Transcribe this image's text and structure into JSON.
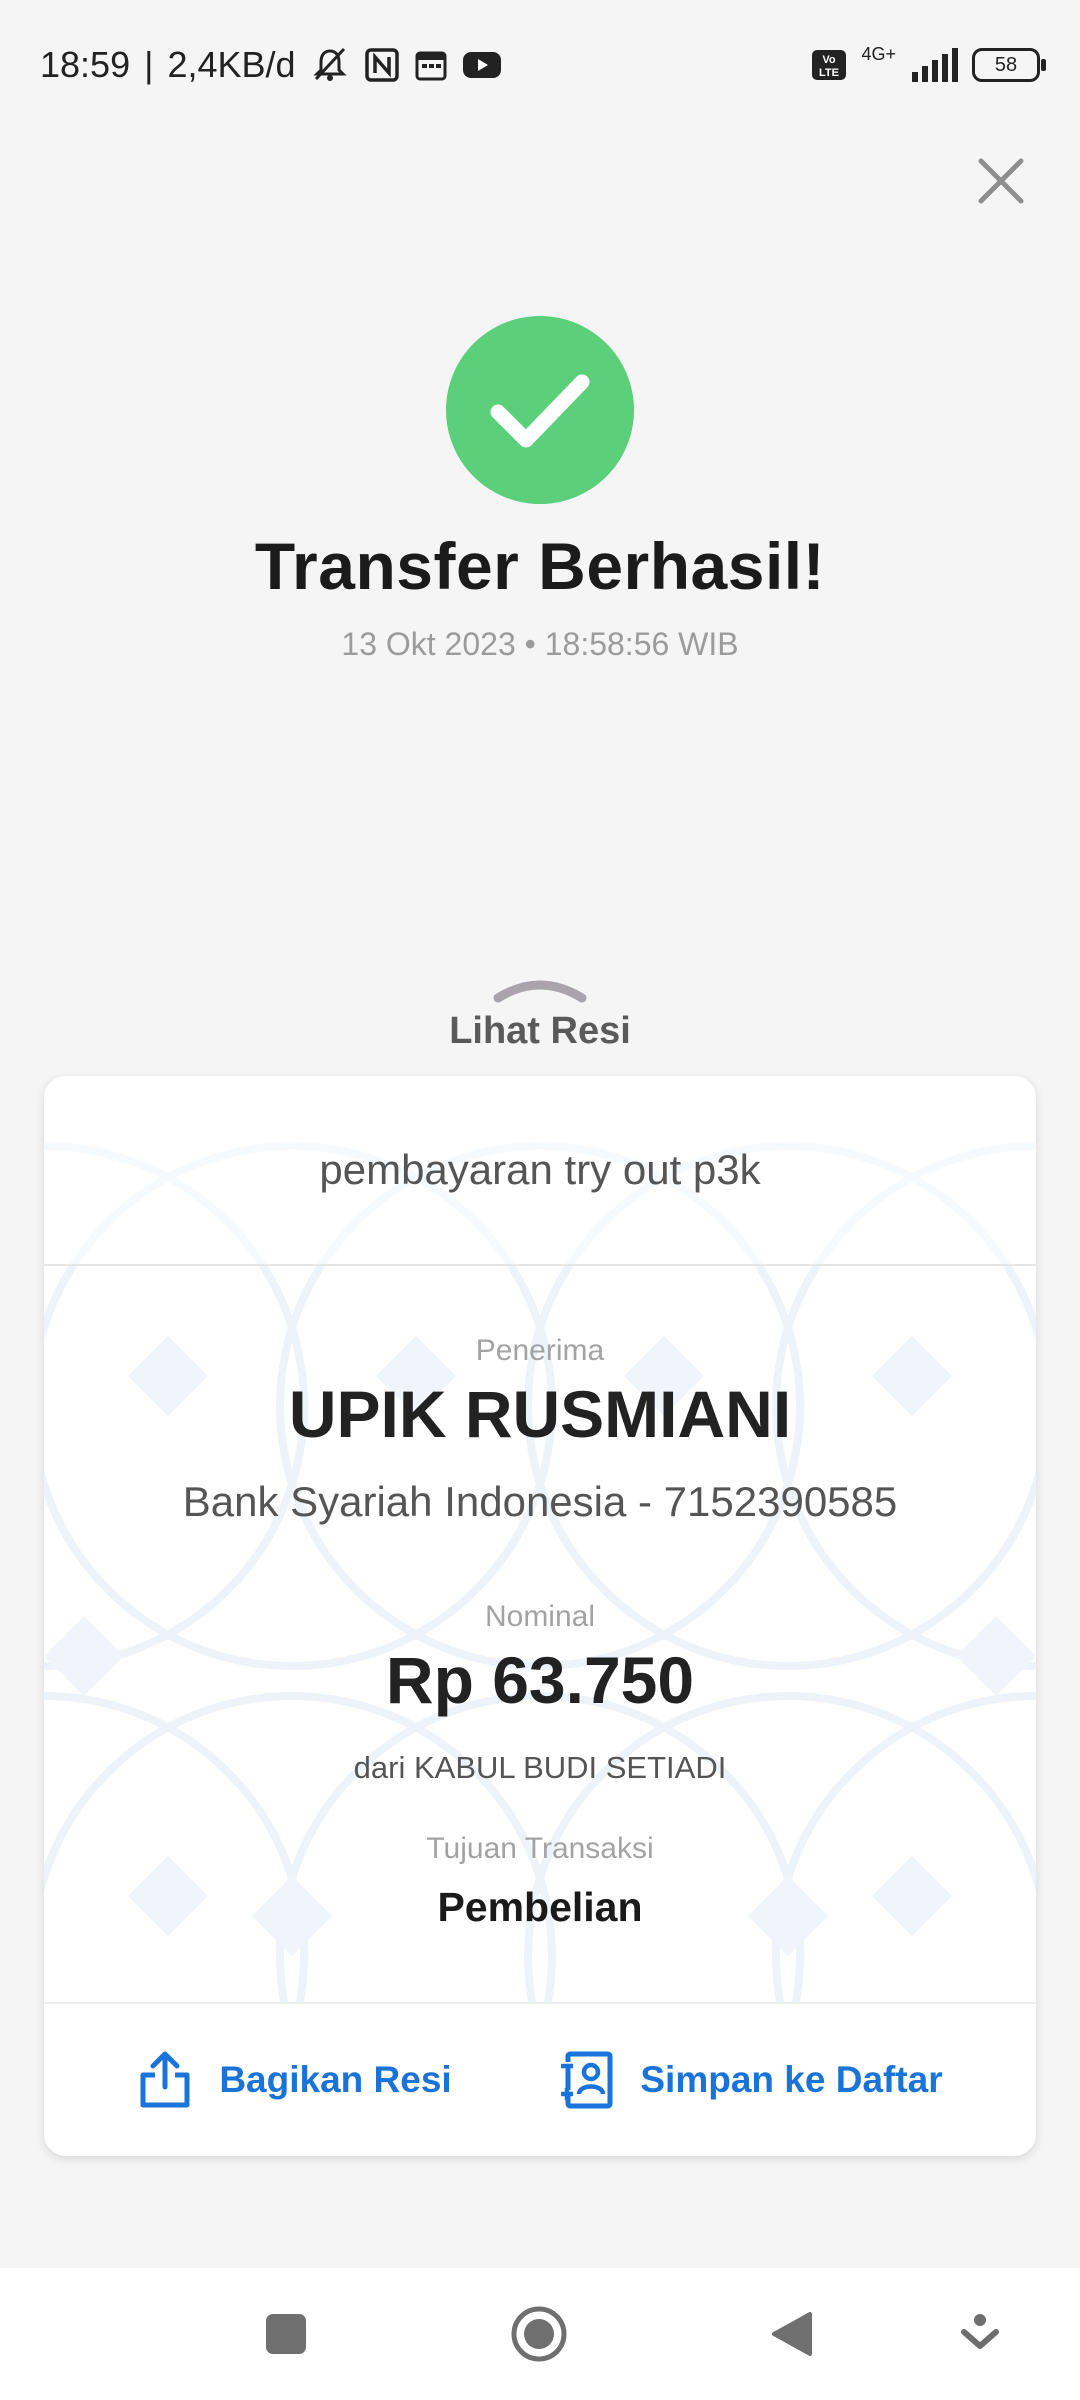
{
  "status_bar": {
    "time": "18:59",
    "separator": "|",
    "net_speed": "2,4KB/d",
    "network_label": "4G+",
    "volte_label": "Vo LTE",
    "battery": "58",
    "icons": [
      "mute-bell-icon",
      "nfc-icon",
      "calendar-icon",
      "youtube-icon",
      "volte-icon",
      "signal-icon",
      "battery-icon"
    ]
  },
  "header": {
    "close_icon": "close-icon",
    "success_icon": "check-circle-icon",
    "title": "Transfer Berhasil!",
    "datetime": "13 Okt 2023 • 18:58:56 WIB"
  },
  "receipt_toggle": {
    "label": "Lihat Resi",
    "icon": "chevron-up-icon"
  },
  "receipt": {
    "note": "pembayaran try out p3k",
    "recipient_label": "Penerima",
    "recipient_name": "UPIK RUSMIANI",
    "recipient_bank": "Bank Syariah Indonesia - 7152390585",
    "amount_label": "Nominal",
    "amount": "Rp 63.750",
    "from": "dari KABUL BUDI SETIADI",
    "purpose_label": "Tujuan Transaksi",
    "purpose": "Pembelian"
  },
  "actions": {
    "share_label": "Bagikan Resi",
    "save_label": "Simpan ke Daftar",
    "accent_color": "#1a73d9"
  },
  "colors": {
    "success": "#5ccf7b",
    "background": "#f5f5f5"
  },
  "nav_bar": {
    "icons": [
      "recents-icon",
      "home-icon",
      "back-icon",
      "hide-nav-icon"
    ]
  }
}
